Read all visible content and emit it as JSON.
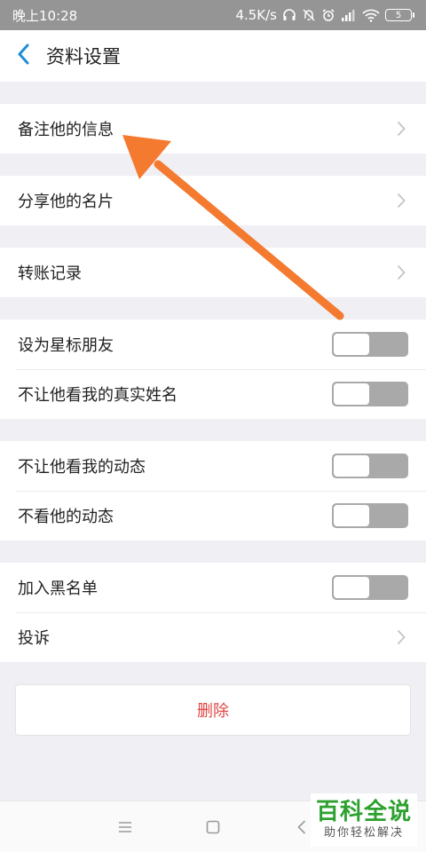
{
  "status_bar": {
    "time": "晚上10:28",
    "net_speed": "4.5K/s",
    "battery": "5",
    "icons": [
      "headphone-icon",
      "mute-bell-icon",
      "alarm-icon",
      "signal-icon",
      "wifi-icon",
      "battery-icon"
    ]
  },
  "header": {
    "title": "资料设置",
    "back_icon": "chevron-left-icon"
  },
  "groups": [
    {
      "items": [
        {
          "label": "备注他的信息",
          "control": "chevron"
        }
      ]
    },
    {
      "items": [
        {
          "label": "分享他的名片",
          "control": "chevron"
        }
      ]
    },
    {
      "items": [
        {
          "label": "转账记录",
          "control": "chevron"
        }
      ]
    },
    {
      "items": [
        {
          "label": "设为星标朋友",
          "control": "switch",
          "on": false
        },
        {
          "label": "不让他看我的真实姓名",
          "control": "switch",
          "on": false
        }
      ]
    },
    {
      "items": [
        {
          "label": "不让他看我的动态",
          "control": "switch",
          "on": false
        },
        {
          "label": "不看他的动态",
          "control": "switch",
          "on": false
        }
      ]
    },
    {
      "items": [
        {
          "label": "加入黑名单",
          "control": "switch",
          "on": false
        },
        {
          "label": "投诉",
          "control": "chevron"
        }
      ]
    }
  ],
  "delete_button": {
    "label": "删除",
    "color": "#e04545"
  },
  "system_nav": {
    "icons": [
      "menu-icon",
      "home-icon",
      "back-icon"
    ]
  },
  "watermark": {
    "title": "百科全说",
    "subtitle": "助你轻松解决",
    "color": "#2da12f"
  },
  "colors": {
    "accent": "#1e8ed8",
    "annotation_arrow": "#f47a30",
    "status_bar": "#959595",
    "switch_off": "#a9a9a9"
  }
}
